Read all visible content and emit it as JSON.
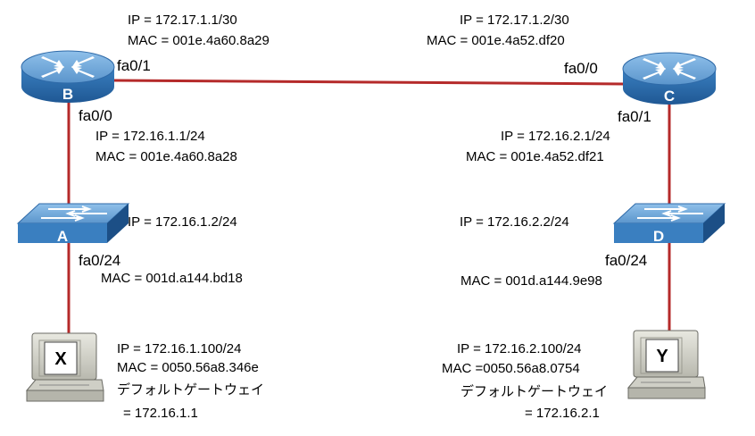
{
  "colors": {
    "link": "#b52a2a",
    "device_top": "#6fa7d8",
    "device_side": "#2f73b3",
    "device_dark": "#1c4f86"
  },
  "nodes": {
    "router_b": {
      "letter": "B",
      "icon": "router-icon"
    },
    "router_c": {
      "letter": "C",
      "icon": "router-icon"
    },
    "switch_a": {
      "letter": "A",
      "icon": "switch-icon"
    },
    "switch_d": {
      "letter": "D",
      "icon": "switch-icon"
    },
    "pc_x": {
      "letter": "X",
      "icon": "pc-icon"
    },
    "pc_y": {
      "letter": "Y",
      "icon": "pc-icon"
    }
  },
  "ports": {
    "b_fa01": "fa0/1",
    "b_fa00": "fa0/0",
    "c_fa00": "fa0/0",
    "c_fa01": "fa0/1",
    "a_fa024": "fa0/24",
    "d_fa024": "fa0/24"
  },
  "labels": {
    "b_wan_ip": "IP = 172.17.1.1/30",
    "b_wan_mac": "MAC = 001e.4a60.8a29",
    "c_wan_ip": "IP = 172.17.1.2/30",
    "c_wan_mac": "MAC = 001e.4a52.df20",
    "b_lan_ip": "IP = 172.16.1.1/24",
    "b_lan_mac": "MAC = 001e.4a60.8a28",
    "c_lan_ip": "IP = 172.16.2.1/24",
    "c_lan_mac": "MAC = 001e.4a52.df21",
    "a_ip": "IP = 172.16.1.2/24",
    "d_ip": "IP = 172.16.2.2/24",
    "a_mac": "MAC = 001d.a144.bd18",
    "d_mac": "MAC = 001d.a144.9e98",
    "x_ip": "IP = 172.16.1.100/24",
    "x_mac": "MAC = 0050.56a8.346e",
    "x_gw_label": "デフォルトゲートウェイ",
    "x_gw_value": "= 172.16.1.1",
    "y_ip": "IP = 172.16.2.100/24",
    "y_mac": "MAC =0050.56a8.0754",
    "y_gw_label": "デフォルトゲートウェイ",
    "y_gw_value": "= 172.16.2.1"
  }
}
